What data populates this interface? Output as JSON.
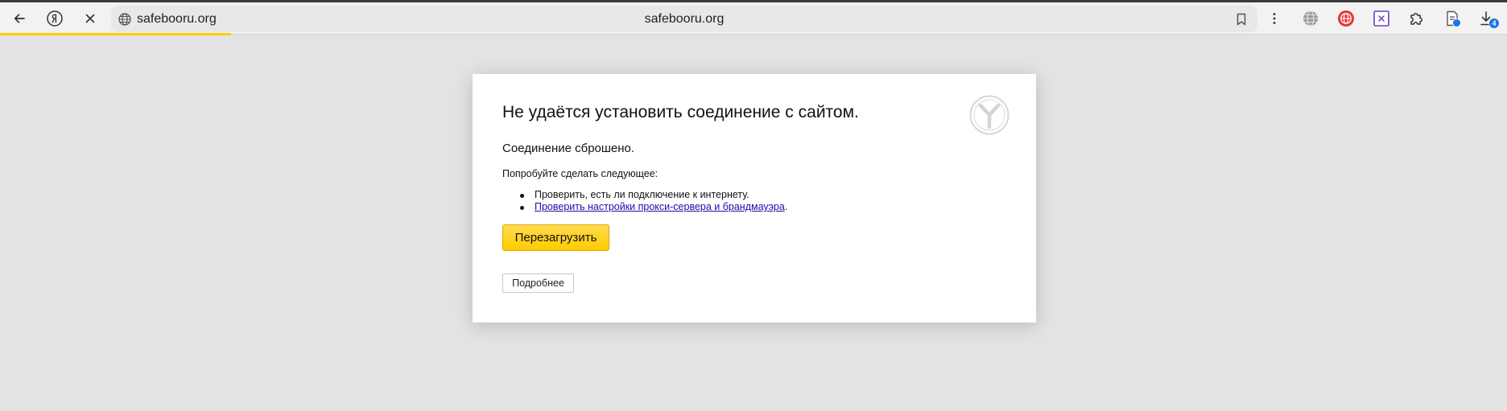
{
  "browser": {
    "url_host": "safebooru.org",
    "page_title": "safebooru.org",
    "download_count": "4",
    "colors": {
      "accent": "#ffcc00",
      "badge": "#1a73e8"
    },
    "icons": [
      "back-arrow-icon",
      "yandex-logo-icon",
      "stop-icon",
      "globe-icon",
      "bookmark-icon",
      "more-menu-icon",
      "translate-icon",
      "vpn-extension-icon",
      "tab-extension-icon",
      "puzzle-icon",
      "reading-list-icon",
      "download-icon"
    ]
  },
  "error_page": {
    "title": "Не удаётся установить соединение с сайтом.",
    "subtitle": "Соединение сброшено.",
    "try_label": "Попробуйте сделать следующее:",
    "suggestions": {
      "check_connection": "Проверить, есть ли подключение к интернету.",
      "check_proxy_link": "Проверить настройки прокси-сервера и брандмауэра",
      "check_proxy_tail": "."
    },
    "reload_label": "Перезагрузить",
    "details_label": "Подробнее"
  }
}
